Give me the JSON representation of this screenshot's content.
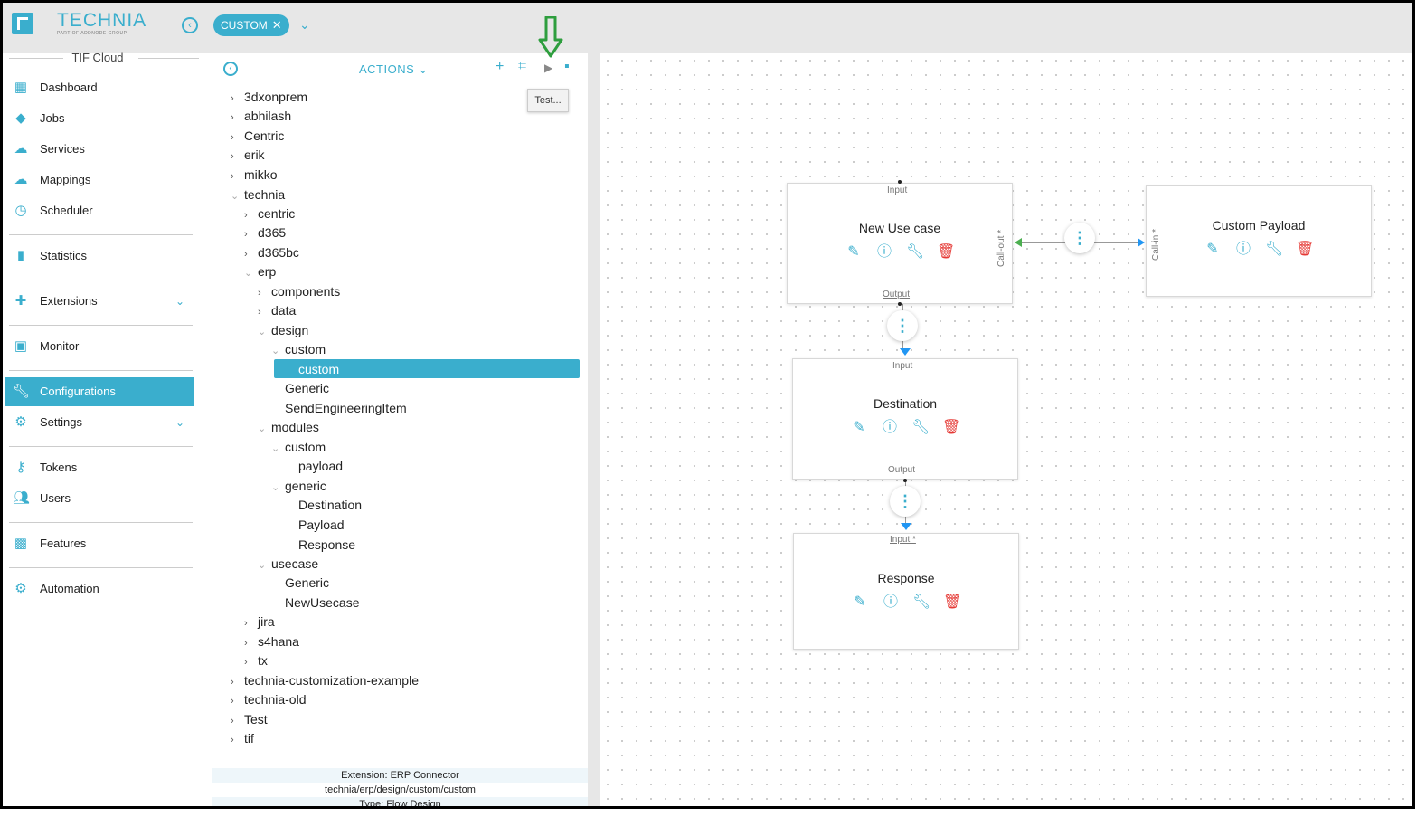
{
  "header": {
    "brand": "TECHNIA",
    "brand_sub": "PART OF ADDNODE GROUP",
    "chip_label": "CUSTOM",
    "chip_close": "✕",
    "back_icon": "arrow-left-circle-icon",
    "dropdown_icon": "chevron-down-icon"
  },
  "sidebar": {
    "title": "TIF Cloud",
    "items": [
      {
        "label": "Dashboard",
        "icon": "dashboard-icon"
      },
      {
        "label": "Jobs",
        "icon": "tag-icon"
      },
      {
        "label": "Services",
        "icon": "cloud-icon"
      },
      {
        "label": "Mappings",
        "icon": "cloud-outline-icon"
      },
      {
        "label": "Scheduler",
        "icon": "clock-icon"
      },
      {
        "label": "Statistics",
        "icon": "bar-chart-icon"
      },
      {
        "label": "Extensions",
        "icon": "puzzle-icon"
      },
      {
        "label": "Monitor",
        "icon": "monitor-icon"
      },
      {
        "label": "Configurations",
        "icon": "wrench-icon"
      },
      {
        "label": "Settings",
        "icon": "gear-icon"
      },
      {
        "label": "Tokens",
        "icon": "key-icon"
      },
      {
        "label": "Users",
        "icon": "users-icon"
      },
      {
        "label": "Features",
        "icon": "features-icon"
      },
      {
        "label": "Automation",
        "icon": "automation-gear-icon"
      }
    ],
    "active": "Configurations"
  },
  "panel": {
    "actions_label": "ACTIONS",
    "tooltip": "Test...",
    "tree": [
      "3dxonprem",
      "abhilash",
      "Centric",
      "erik",
      "mikko",
      "technia",
      "centric",
      "d365",
      "d365bc",
      "erp",
      "components",
      "data",
      "design",
      "custom",
      "custom",
      "Generic",
      "SendEngineeringItem",
      "modules",
      "custom",
      "payload",
      "generic",
      "Destination",
      "Payload",
      "Response",
      "usecase",
      "Generic",
      "NewUsecase",
      "jira",
      "s4hana",
      "tx",
      "technia-customization-example",
      "technia-old",
      "Test",
      "tif"
    ],
    "footer": {
      "line1": "Extension: ERP Connector",
      "line2": "technia/erp/design/custom/custom",
      "line3": "Type: Flow Design"
    }
  },
  "canvas": {
    "nodes": [
      {
        "title": "New Use case",
        "input": "Input",
        "output": "Output",
        "side": "Call-out *"
      },
      {
        "title": "Custom Payload",
        "side": "Call-in *"
      },
      {
        "title": "Destination",
        "input": "Input",
        "output": "Output"
      },
      {
        "title": "Response",
        "input": "Input *"
      }
    ],
    "node_actions": [
      "edit-icon",
      "info-icon",
      "wrench-icon",
      "delete-icon"
    ],
    "connector_icon": "more-vertical-icon"
  },
  "colors": {
    "accent": "#3aaecd",
    "danger": "#e53935",
    "annotation": "#2e9e3e"
  }
}
